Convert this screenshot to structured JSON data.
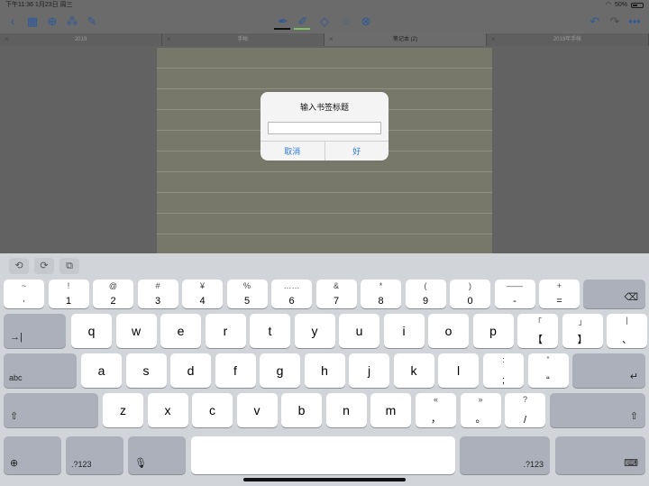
{
  "status": {
    "time_date": "下午11:36  1月23日 周三",
    "battery": "50%"
  },
  "tabs": [
    {
      "label": "2019",
      "active": false
    },
    {
      "label": "手帐",
      "active": false
    },
    {
      "label": "笔记本 (2)",
      "active": true
    },
    {
      "label": "2019年手帐",
      "active": false
    }
  ],
  "dialog": {
    "title": "输入书签标题",
    "input_value": "",
    "cancel": "取消",
    "ok": "好"
  },
  "assist": {
    "undo": "⟲",
    "redo": "⟳",
    "paste": "⧉"
  },
  "keyboard": {
    "row1": [
      {
        "top": "~",
        "bot": "·"
      },
      {
        "top": "!",
        "bot": "1"
      },
      {
        "top": "@",
        "bot": "2"
      },
      {
        "top": "#",
        "bot": "3"
      },
      {
        "top": "¥",
        "bot": "4"
      },
      {
        "top": "%",
        "bot": "5"
      },
      {
        "top": "……",
        "bot": "6"
      },
      {
        "top": "&",
        "bot": "7"
      },
      {
        "top": "*",
        "bot": "8"
      },
      {
        "top": "(",
        "bot": "9"
      },
      {
        "top": ")",
        "bot": "0"
      },
      {
        "top": "——",
        "bot": "-"
      },
      {
        "top": "+",
        "bot": "="
      }
    ],
    "row2": [
      "q",
      "w",
      "e",
      "r",
      "t",
      "y",
      "u",
      "i",
      "o",
      "p"
    ],
    "row2_extra": [
      {
        "top": "「",
        "bot": "【"
      },
      {
        "top": "」",
        "bot": "】"
      },
      {
        "top": "|",
        "bot": "、"
      }
    ],
    "row3": [
      "a",
      "s",
      "d",
      "f",
      "g",
      "h",
      "j",
      "k",
      "l"
    ],
    "row3_extra": [
      {
        "top": ":",
        "bot": ";"
      },
      {
        "top": "”",
        "bot": "“"
      }
    ],
    "row4": [
      "z",
      "x",
      "c",
      "v",
      "b",
      "n",
      "m"
    ],
    "row4_extra": [
      {
        "top": "«",
        "bot": "，"
      },
      {
        "top": "»",
        "bot": "。"
      },
      {
        "top": "?",
        "bot": "/"
      }
    ],
    "tab_label": "→|",
    "abc_label": "abc",
    "shift_glyph": "⇧",
    "delete_glyph": "⌫",
    "return_glyph": "↵",
    "num_label": ".?123",
    "globe_glyph": "⊕",
    "mic_glyph": "🎙",
    "dismiss_glyph": "⌨"
  }
}
